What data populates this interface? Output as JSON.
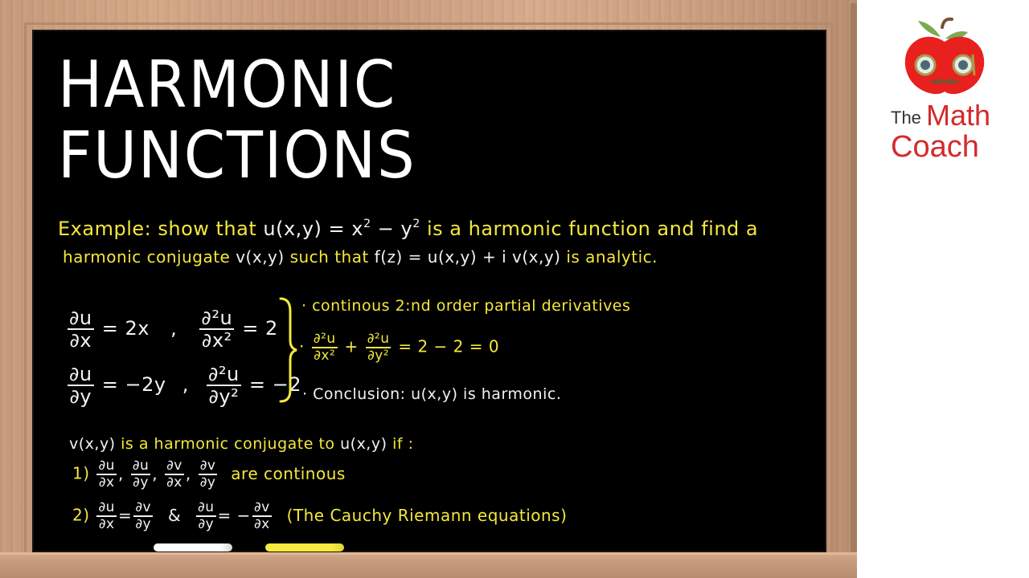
{
  "title": {
    "line1": "HARMONIC",
    "line2": "FUNCTIONS"
  },
  "logo": {
    "the": "The",
    "math": "Math",
    "coach": "Coach",
    "icon": "apple-with-glasses-icon",
    "colors": {
      "apple": "#e8201e",
      "leaf": "#7bab4e",
      "text_red": "#d42a2a",
      "text_dark": "#333333"
    }
  },
  "example": {
    "label": "Example:",
    "line1_a": "show that",
    "line1_u": "u(x,y) = x",
    "line1_sup1": "2",
    "line1_minus": " − y",
    "line1_sup2": "2",
    "line1_b": "is a harmonic function and find a",
    "line2_a": "harmonic conjugate",
    "line2_v": "v(x,y)",
    "line2_b": "such that",
    "line2_f": "f(z) = u(x,y) + i v(x,y)",
    "line2_c": "is analytic."
  },
  "derivatives": {
    "du": "∂u",
    "dx": "∂x",
    "dy": "∂y",
    "d2u": "∂²u",
    "dx2": "∂x²",
    "dy2": "∂y²",
    "eq_dudx": "= 2x",
    "eq_d2udx2": "= 2",
    "eq_dudy": "= −2y",
    "eq_d2udy2": "= −2",
    "comma": ","
  },
  "bullets": {
    "b1": "· continous 2:nd order partial derivatives",
    "b2_dot": "·",
    "b2_plus": "+",
    "b2_result": "= 2 − 2 = 0",
    "b3_dot": "·",
    "b3_label": "Conclusion:",
    "b3_u": "u(x,y)",
    "b3_rest": "is harmonic."
  },
  "conjugate": {
    "v": "v(x,y)",
    "text": "is a harmonic conjugate to",
    "u": "u(x,y)",
    "if": "if :",
    "item1_num": "1)",
    "item1_rest": "are continous",
    "dv": "∂v",
    "item2_num": "2)",
    "item2_eq": "=",
    "item2_and": "&",
    "item2_neg": "= −",
    "item2_note": "(The Cauchy Riemann equations)"
  },
  "colors": {
    "board": "#000000",
    "chalk_white": "#f2f2f2",
    "chalk_yellow": "#f4e83c",
    "wood": "#c99d7e"
  }
}
